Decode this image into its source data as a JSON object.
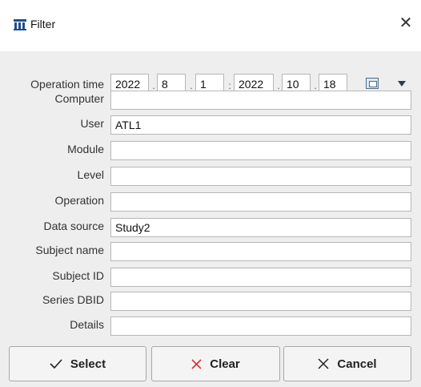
{
  "window": {
    "title": "Filter",
    "close_glyph": "✕"
  },
  "icons": {
    "app": "filter-app-icon",
    "close": "close-icon",
    "calendar": "calendar-icon",
    "dropdown": "dropdown-arrow-icon",
    "select": "checkmark-icon",
    "clear": "red-x-icon",
    "cancel": "x-icon"
  },
  "colors": {
    "clear_icon": "#e03030",
    "panel_bg": "#eeeeee"
  },
  "operation_time": {
    "label": "Operation time",
    "from": {
      "year": "2022",
      "month": "8",
      "day": "1"
    },
    "to": {
      "year": "2022",
      "month": "10",
      "day": "18"
    },
    "date_separator": ".",
    "range_separator": ":"
  },
  "fields": [
    {
      "label": "Computer",
      "value": ""
    },
    {
      "label": "User",
      "value": "ATL1"
    },
    {
      "label": "Module",
      "value": ""
    },
    {
      "label": "Level",
      "value": ""
    },
    {
      "label": "Operation",
      "value": ""
    },
    {
      "label": "Data source",
      "value": "Study2"
    },
    {
      "label": "Subject name",
      "value": ""
    },
    {
      "label": "Subject ID",
      "value": ""
    },
    {
      "label": "Series DBID",
      "value": ""
    },
    {
      "label": "Details",
      "value": ""
    }
  ],
  "buttons": {
    "select": "Select",
    "clear": "Clear",
    "cancel": "Cancel"
  }
}
